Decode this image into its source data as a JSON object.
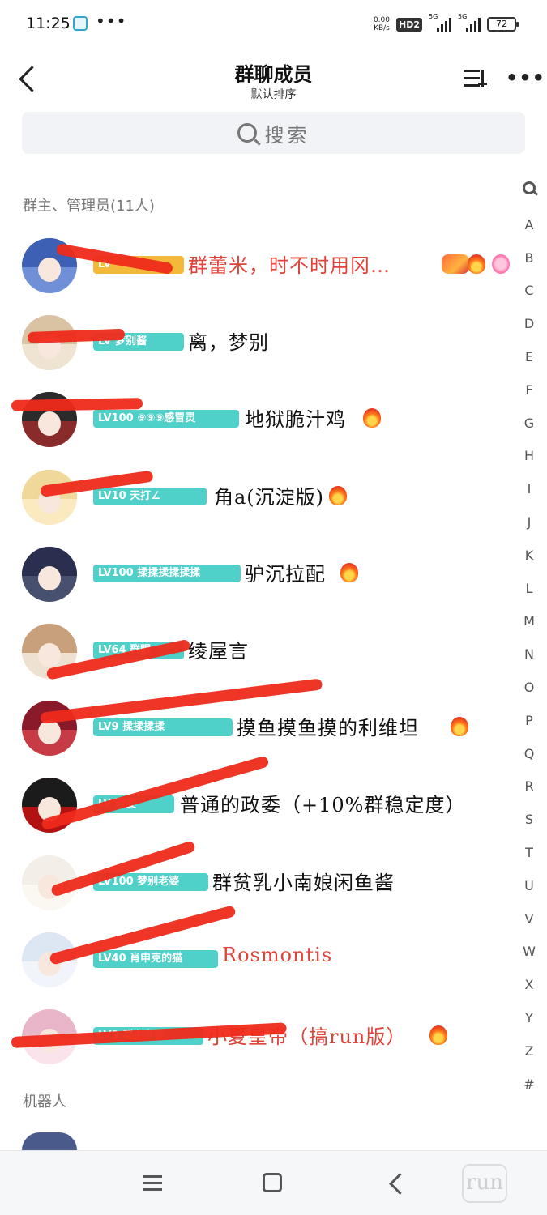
{
  "status_bar": {
    "time": "11:25",
    "dots": "•••",
    "net_speed_value": "0.00",
    "net_speed_unit": "KB/s",
    "hd": "HD2",
    "signal1": "5G",
    "signal2": "5G",
    "battery": "72"
  },
  "header": {
    "title": "群聊成员",
    "subtitle": "默认排序"
  },
  "search": {
    "placeholder": "搜索"
  },
  "sections": {
    "admins": "群主、管理员(11人)",
    "bots": "机器人"
  },
  "members": [
    {
      "level": "LV",
      "name": "群蕾米，时不时用冈…",
      "name_color": "#e0433a",
      "badge_color": "#f3b93b",
      "emojis": [
        "dragon-icon",
        "fire-icon",
        "smile-icon"
      ]
    },
    {
      "level": "LV  梦别酱",
      "name": "离，梦别",
      "name_color": "#111111",
      "badge_color": "#4fd0c9",
      "emojis": []
    },
    {
      "level": "LV100 ⑨⑨⑨感冒灵",
      "name": "地狱脆汁鸡",
      "name_color": "#111111",
      "badge_color": "#4fd0c9",
      "emojis": [
        "fire-icon"
      ]
    },
    {
      "level": "LV10  天打∠",
      "name": "角a(沉淀版)",
      "name_color": "#111111",
      "badge_color": "#4fd0c9",
      "emojis": [
        "fire-icon"
      ]
    },
    {
      "level": "LV100 揉揉揉揉揉揉",
      "name": "驴沉拉配",
      "name_color": "#111111",
      "badge_color": "#4fd0c9",
      "emojis": [
        "fire-icon"
      ]
    },
    {
      "level": "LV64 群眠",
      "name": "绫屋言",
      "name_color": "#111111",
      "badge_color": "#4fd0c9",
      "emojis": []
    },
    {
      "level": "LV9   揉揉揉揉",
      "name": "摸鱼摸鱼摸的利维坦",
      "name_color": "#111111",
      "badge_color": "#4fd0c9",
      "emojis": [
        "fire-icon"
      ]
    },
    {
      "level": "LV  政委",
      "name": "普通的政委（+10%群稳定度）",
      "name_color": "#111111",
      "badge_color": "#4fd0c9",
      "emojis": []
    },
    {
      "level": "LV100 梦别老婆",
      "name": "群贫乳小南娘闲鱼酱",
      "name_color": "#111111",
      "badge_color": "#4fd0c9",
      "emojis": []
    },
    {
      "level": "LV40 肖申克的猫",
      "name": "Rosmontis",
      "name_color": "#e0433a",
      "badge_color": "#4fd0c9",
      "emojis": []
    },
    {
      "level": "LV9 群主老婆",
      "name": "小夏皇帝（搞run版）",
      "name_color": "#e0433a",
      "badge_color": "#4fd0c9",
      "emojis": [
        "fire-icon"
      ]
    }
  ],
  "index_letters": [
    "A",
    "B",
    "C",
    "D",
    "E",
    "F",
    "G",
    "H",
    "I",
    "J",
    "K",
    "L",
    "M",
    "N",
    "O",
    "P",
    "Q",
    "R",
    "S",
    "T",
    "U",
    "V",
    "W",
    "X",
    "Y",
    "Z",
    "#"
  ],
  "watermark": "run"
}
